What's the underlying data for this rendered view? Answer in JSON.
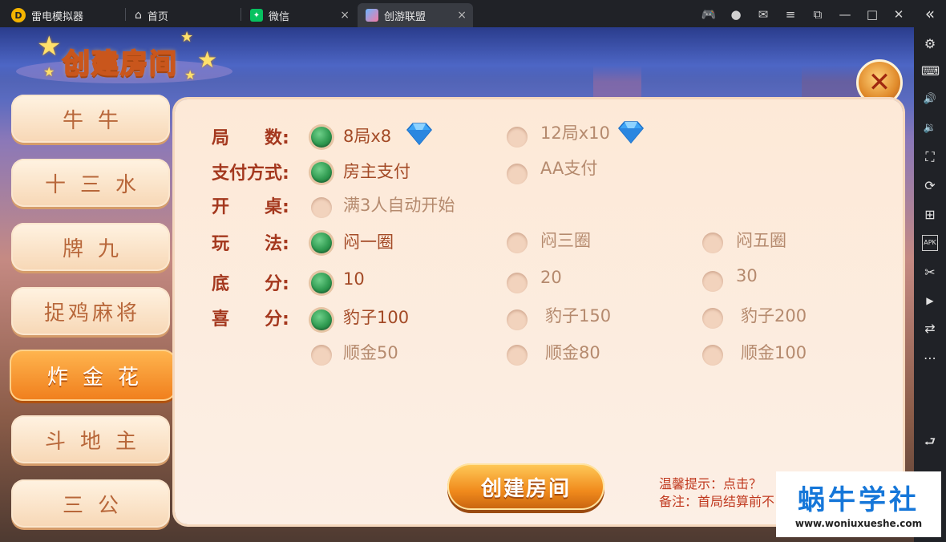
{
  "titlebar": {
    "app_name": "雷电模拟器",
    "app_icon_glyph": "D",
    "tabs": [
      {
        "label": "首页",
        "icon": "home-icon"
      },
      {
        "label": "微信",
        "icon": "wechat-icon"
      },
      {
        "label": "创游联盟",
        "icon": "game-icon",
        "active": true
      }
    ],
    "close_glyph": "×",
    "buttons": [
      {
        "name": "gamepad-icon",
        "glyph": "🎮"
      },
      {
        "name": "account-icon",
        "glyph": "●"
      },
      {
        "name": "mail-icon",
        "glyph": "✉"
      },
      {
        "name": "menu-icon",
        "glyph": "≡"
      },
      {
        "name": "restore-icon",
        "glyph": "⧉"
      },
      {
        "name": "minimize-icon",
        "glyph": "—"
      },
      {
        "name": "maximize-icon",
        "glyph": "□"
      },
      {
        "name": "window-close-icon",
        "glyph": "✕"
      }
    ]
  },
  "sidebar_right": {
    "icons": [
      {
        "name": "collapse-icon",
        "glyph": "«"
      },
      {
        "name": "settings-icon",
        "glyph": "⚙"
      },
      {
        "name": "keyboard-icon",
        "glyph": "⌨"
      },
      {
        "name": "volume-up-icon",
        "glyph": "🔊"
      },
      {
        "name": "volume-down-icon",
        "glyph": "🔉"
      },
      {
        "name": "screenshot-icon",
        "glyph": "⛶"
      },
      {
        "name": "rotate-icon",
        "glyph": "⟳"
      },
      {
        "name": "multi-instance-icon",
        "glyph": "⊞"
      },
      {
        "name": "apk-icon",
        "glyph": "APK"
      },
      {
        "name": "scissors-icon",
        "glyph": "✂"
      },
      {
        "name": "record-icon",
        "glyph": "▶"
      },
      {
        "name": "sync-icon",
        "glyph": "⇄"
      },
      {
        "name": "more-icon",
        "glyph": "⋯"
      },
      {
        "name": "back-icon",
        "glyph": "⮐"
      }
    ]
  },
  "game": {
    "title": "创建房间",
    "close_glyph": "✕",
    "menu": [
      {
        "label": "牛牛"
      },
      {
        "label": "十三水"
      },
      {
        "label": "牌九"
      },
      {
        "label": "捉鸡麻将"
      },
      {
        "label": "炸金花",
        "active": true
      },
      {
        "label": "斗地主"
      },
      {
        "label": "三公"
      }
    ],
    "rows": {
      "rounds": {
        "label": "局　　数:",
        "options": [
          {
            "text": "8局x8",
            "selected": true
          },
          {
            "text": "12局x10",
            "selected": false
          }
        ]
      },
      "payment": {
        "label": "支付方式:",
        "options": [
          {
            "text": "房主支付",
            "selected": true
          },
          {
            "text": "AA支付",
            "selected": false
          }
        ]
      },
      "start": {
        "label": "开　　桌:",
        "options": [
          {
            "text": "满3人自动开始",
            "selected": false
          }
        ]
      },
      "rule": {
        "label": "玩　　法:",
        "options": [
          {
            "text": "闷一圈",
            "selected": true
          },
          {
            "text": "闷三圈",
            "selected": false
          },
          {
            "text": "闷五圈",
            "selected": false
          }
        ]
      },
      "base": {
        "label": "底　　分:",
        "options": [
          {
            "text": "10",
            "selected": true
          },
          {
            "text": "20",
            "selected": false
          },
          {
            "text": "30",
            "selected": false
          }
        ]
      },
      "bonus": {
        "label": "喜　　分:",
        "options": [
          {
            "text": "豹子100",
            "selected": true
          },
          {
            "text": "豹子150",
            "selected": false
          },
          {
            "text": "豹子200",
            "selected": false
          },
          {
            "text": "顺金50",
            "selected": false
          },
          {
            "text": "顺金80",
            "selected": false
          },
          {
            "text": "顺金100",
            "selected": false
          }
        ]
      }
    },
    "create_button": "创建房间",
    "tip_line1": "温馨提示：点击？",
    "tip_line2": "备注：首局结算前不",
    "colors": {
      "accent": "#f08a1c",
      "selected_radio": "#2f9a50",
      "label_red": "#a4381e"
    }
  },
  "watermark": {
    "title": "蜗牛学社",
    "url": "www.woniuxueshe.com"
  }
}
